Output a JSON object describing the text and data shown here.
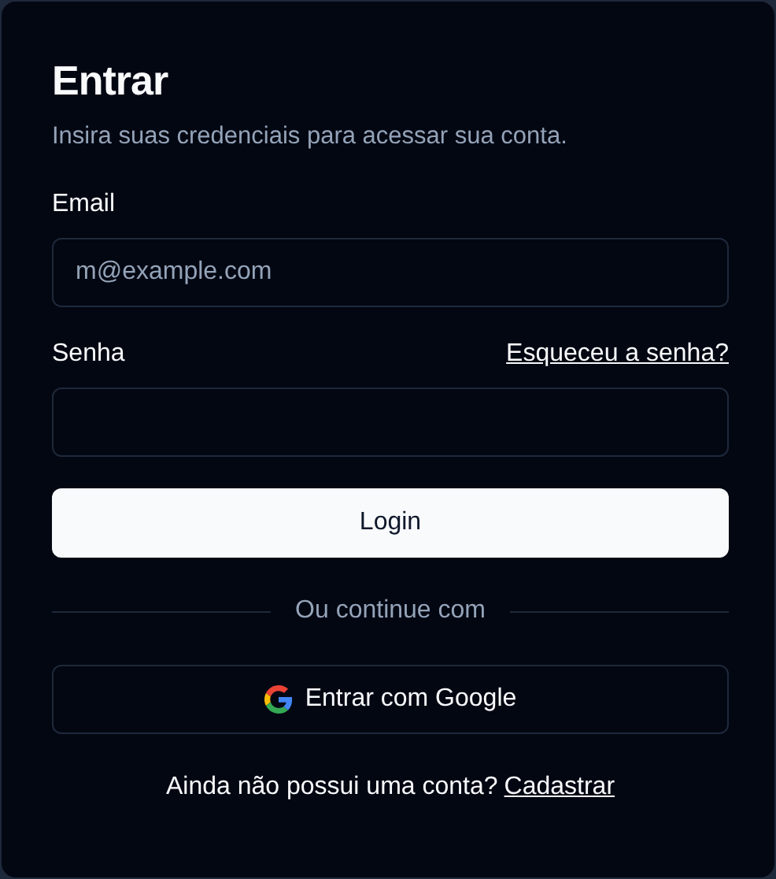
{
  "card": {
    "title": "Entrar",
    "description": "Insira suas credenciais para acessar sua conta."
  },
  "fields": [
    {
      "label": "Email",
      "placeholder": "m@example.com"
    },
    {
      "label": "Senha",
      "link": "Esqueceu a senha?"
    }
  ],
  "submit": "Login",
  "divider": "Ou continue com",
  "social_button": "Entrar com Google",
  "footer": {
    "text": "Ainda não possui uma conta?",
    "link": "Cadastrar"
  }
}
